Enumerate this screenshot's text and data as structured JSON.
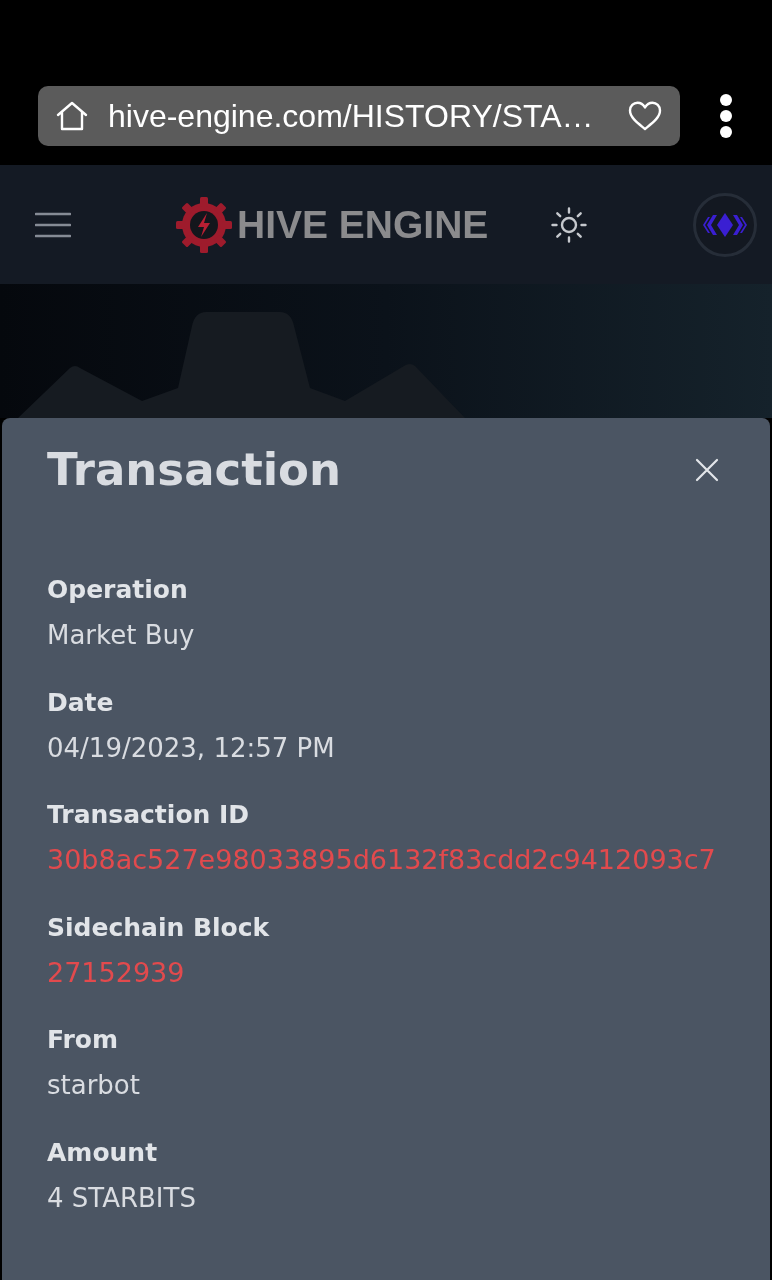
{
  "browser": {
    "url": "hive-engine.com/HISTORY/STA…"
  },
  "header": {
    "logo_text": "HIVE ENGINE"
  },
  "modal": {
    "title": "Transaction",
    "fields": [
      {
        "label": "Operation",
        "value": "Market Buy",
        "kind": "text"
      },
      {
        "label": "Date",
        "value": "04/19/2023, 12:57 PM",
        "kind": "text"
      },
      {
        "label": "Transaction ID",
        "value": "30b8ac527e98033895d6132f83cdd2c9412093c7",
        "kind": "link"
      },
      {
        "label": "Sidechain Block",
        "value": "27152939",
        "kind": "link"
      },
      {
        "label": "From",
        "value": "starbot",
        "kind": "text"
      },
      {
        "label": "Amount",
        "value": "4 STARBITS",
        "kind": "text"
      }
    ]
  }
}
